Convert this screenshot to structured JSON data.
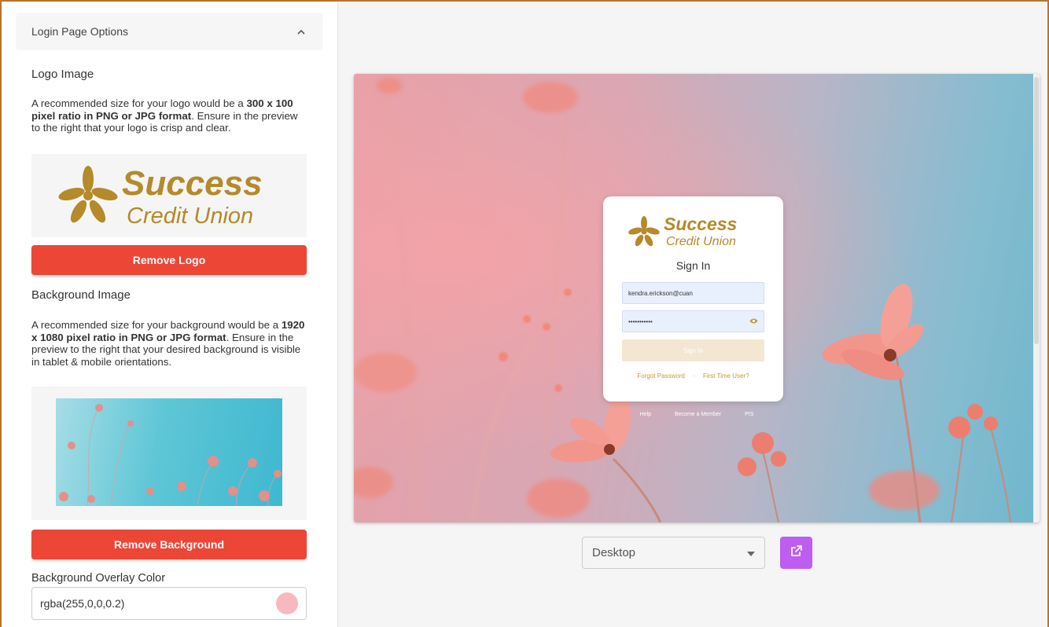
{
  "accordion": {
    "title": "Login Page Options"
  },
  "logo_section": {
    "label": "Logo Image",
    "desc_pre": "A recommended size for your logo would be a ",
    "desc_bold": "300 x 100 pixel ratio in PNG or JPG format",
    "desc_post": ". Ensure in the preview to the right that your logo is crisp and clear.",
    "remove_label": "Remove Logo"
  },
  "brand": {
    "name": "Success",
    "sub": "Credit Union",
    "color": "#b48a2a"
  },
  "background_section": {
    "label": "Background Image",
    "desc_pre": "A recommended size for your background would be a ",
    "desc_bold": "1920 x 1080 pixel ratio in PNG or JPG format",
    "desc_post": ". Ensure in the preview to the right that your desired background is visible in tablet & mobile orientations.",
    "remove_label": "Remove Background"
  },
  "overlay": {
    "label": "Background Overlay Color",
    "value": "rgba(255,0,0,0.2)",
    "swatch_color": "#f7b9bd"
  },
  "login_card": {
    "title": "Sign In",
    "username": "kendra.erickson@cuan",
    "password": "•••••••••••",
    "signin_label": "Sign In",
    "forgot": "Forgot Password",
    "separator": "·",
    "first_time": "First Time User?"
  },
  "footer_links": [
    "Help",
    "Become a Member",
    "PIS"
  ],
  "device_select": {
    "value": "Desktop"
  },
  "colors": {
    "accent_red": "#ec4637",
    "accent_purple": "#bd5ef0",
    "border": "#b8742c"
  }
}
